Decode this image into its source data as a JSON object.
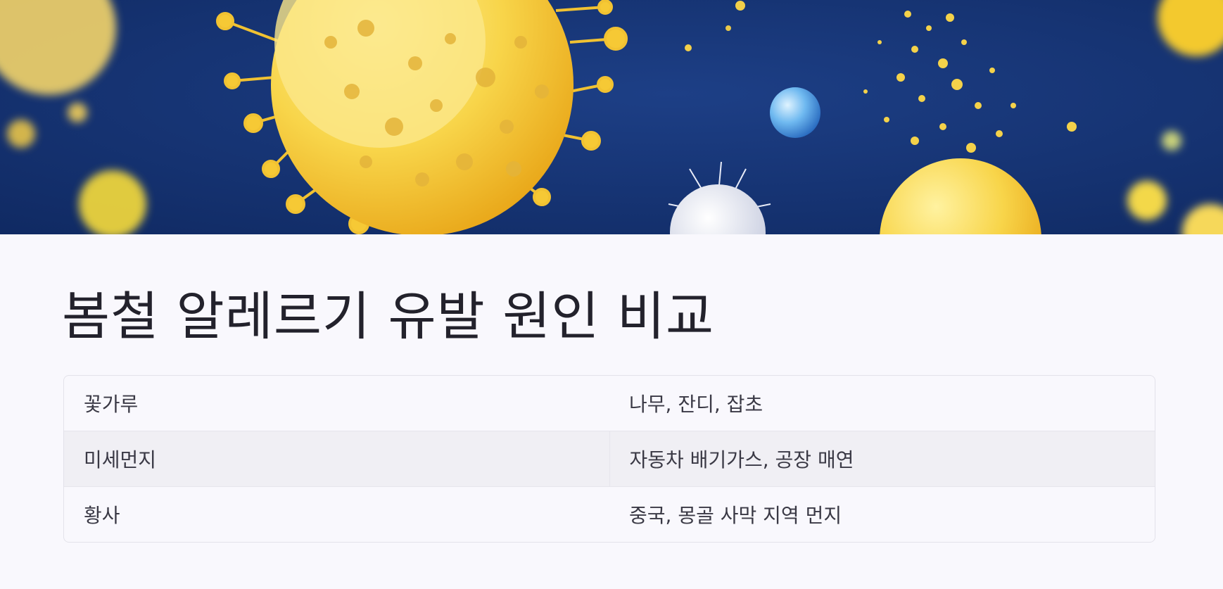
{
  "page": {
    "title": "봄철 알레르기 유발 원인 비교"
  },
  "hero": {
    "image": "pollen-and-dust-particles-illustration",
    "background_color": "#13306e",
    "accent_color": "#f7c531"
  },
  "comparison_table": {
    "rows": [
      {
        "cause": "꽃가루",
        "source": "나무, 잔디, 잡초"
      },
      {
        "cause": "미세먼지",
        "source": "자동차 배기가스, 공장 매연"
      },
      {
        "cause": "황사",
        "source": "중국, 몽골 사막 지역 먼지"
      }
    ]
  }
}
